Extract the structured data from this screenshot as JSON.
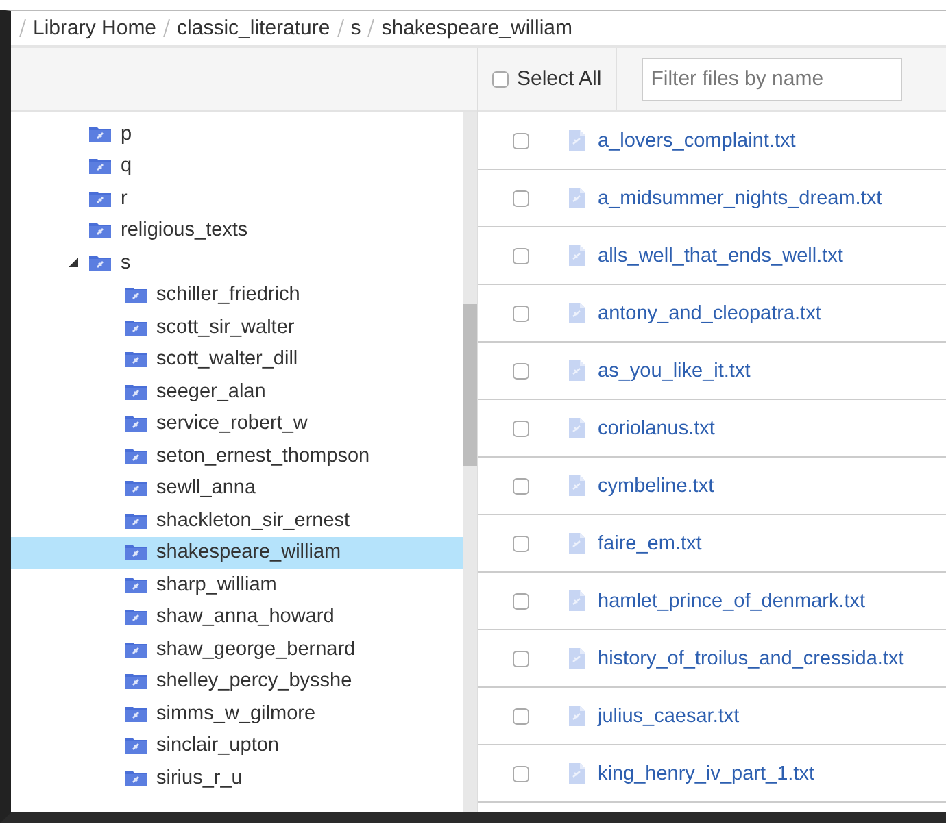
{
  "breadcrumb": [
    "Library Home",
    "classic_literature",
    "s",
    "shakespeare_william"
  ],
  "toolbar": {
    "select_all": {
      "label": "Select All",
      "checked": false
    },
    "filter": {
      "placeholder": "Filter files by name"
    }
  },
  "tree": [
    {
      "label": "p",
      "selected": false
    },
    {
      "label": "q",
      "selected": false
    },
    {
      "label": "r",
      "selected": false
    },
    {
      "label": "religious_texts",
      "selected": false
    },
    {
      "label": "s",
      "selected": false,
      "expanded": true,
      "children": [
        {
          "label": "schiller_friedrich",
          "selected": false
        },
        {
          "label": "scott_sir_walter",
          "selected": false
        },
        {
          "label": "scott_walter_dill",
          "selected": false
        },
        {
          "label": "seeger_alan",
          "selected": false
        },
        {
          "label": "service_robert_w",
          "selected": false
        },
        {
          "label": "seton_ernest_thompson",
          "selected": false
        },
        {
          "label": "sewll_anna",
          "selected": false
        },
        {
          "label": "shackleton_sir_ernest",
          "selected": false
        },
        {
          "label": "shakespeare_william",
          "selected": true
        },
        {
          "label": "sharp_william",
          "selected": false
        },
        {
          "label": "shaw_anna_howard",
          "selected": false
        },
        {
          "label": "shaw_george_bernard",
          "selected": false
        },
        {
          "label": "shelley_percy_bysshe",
          "selected": false
        },
        {
          "label": "simms_w_gilmore",
          "selected": false
        },
        {
          "label": "sinclair_upton",
          "selected": false
        },
        {
          "label": "sirius_r_u",
          "selected": false
        }
      ]
    }
  ],
  "files": [
    {
      "name": "a_lovers_complaint.txt",
      "checked": false
    },
    {
      "name": "a_midsummer_nights_dream.txt",
      "checked": false
    },
    {
      "name": "alls_well_that_ends_well.txt",
      "checked": false
    },
    {
      "name": "antony_and_cleopatra.txt",
      "checked": false
    },
    {
      "name": "as_you_like_it.txt",
      "checked": false
    },
    {
      "name": "coriolanus.txt",
      "checked": false
    },
    {
      "name": "cymbeline.txt",
      "checked": false
    },
    {
      "name": "faire_em.txt",
      "checked": false
    },
    {
      "name": "hamlet_prince_of_denmark.txt",
      "checked": false
    },
    {
      "name": "history_of_troilus_and_cressida.txt",
      "checked": false
    },
    {
      "name": "julius_caesar.txt",
      "checked": false
    },
    {
      "name": "king_henry_iv_part_1.txt",
      "checked": false
    }
  ]
}
